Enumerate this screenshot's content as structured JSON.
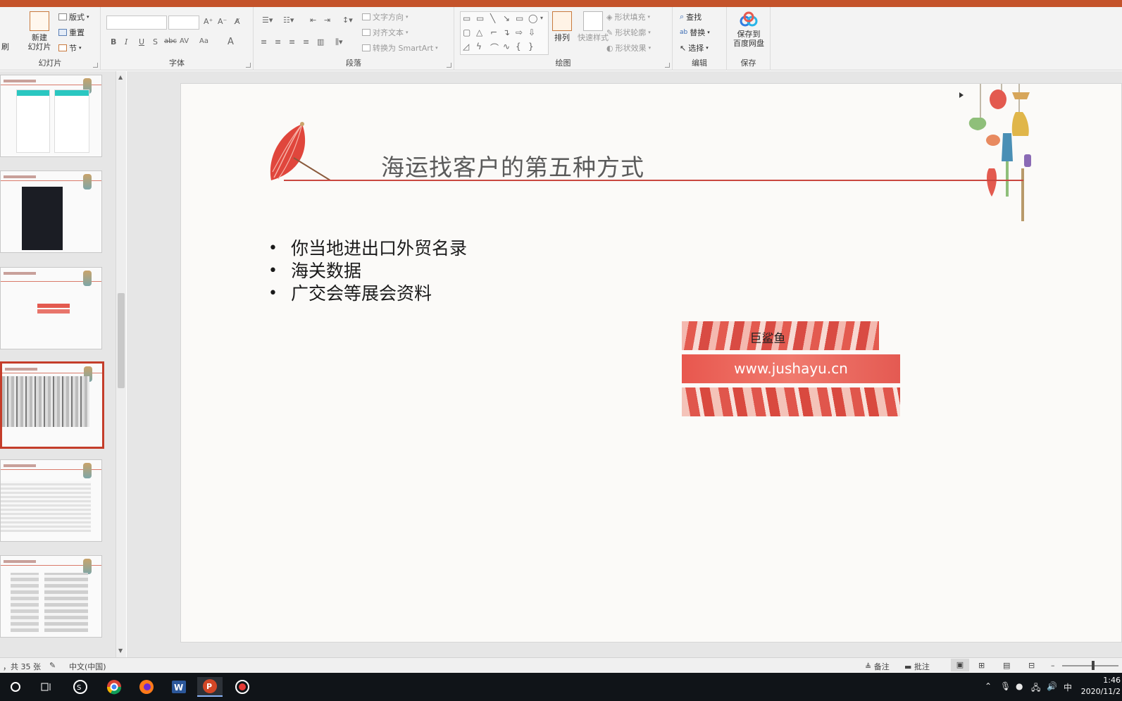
{
  "ribbon": {
    "slides_group": {
      "new_slide": "新建\n幻灯片",
      "layout": "版式",
      "reset": "重置",
      "section": "节",
      "label": "幻灯片",
      "left_partial": "刷"
    },
    "font_group": {
      "label": "字体",
      "bold": "B",
      "italic": "I",
      "underline": "U",
      "strike": "S",
      "abc": "abc",
      "av": "AV",
      "aa": "Aa",
      "font_color": "A"
    },
    "paragraph_group": {
      "label": "段落",
      "text_direction": "文字方向",
      "align_text": "对齐文本",
      "smartart": "转换为 SmartArt"
    },
    "drawing_group": {
      "label": "绘图",
      "arrange": "排列",
      "quick_styles": "快速样式",
      "shape_fill": "形状填充",
      "shape_outline": "形状轮廓",
      "shape_effects": "形状效果"
    },
    "editing_group": {
      "label": "编辑",
      "find": "查找",
      "replace": "替换",
      "select": "选择"
    },
    "save_group": {
      "label": "保存",
      "save_baidu": "保存到\n百度网盘"
    }
  },
  "slide": {
    "title": "海运找客户的第五种方式",
    "bullets": [
      "你当地进出口外贸名录",
      "海关数据",
      "广交会等展会资料"
    ],
    "brand_name": "巨鲨鱼",
    "brand_url": "www.jushayu.cn"
  },
  "thumbnails": {
    "count_visible": 6,
    "active_index": 3
  },
  "statusbar": {
    "slide_count": "，共 35 张",
    "language": "中文(中国)",
    "notes": "备注",
    "comments": "批注"
  },
  "taskbar": {
    "ime": "中",
    "time": "1:46",
    "date": "2020/11/2"
  },
  "colors": {
    "accent": "#c4532a",
    "title_rule": "#c9473f",
    "active_thumb": "#c43d2a",
    "banner_red": "#e8574e"
  },
  "icons": [
    "windows-search-icon",
    "task-view-icon",
    "sogou-icon",
    "chrome-icon",
    "firefox-icon",
    "word-icon",
    "powerpoint-icon",
    "recorder-icon"
  ]
}
